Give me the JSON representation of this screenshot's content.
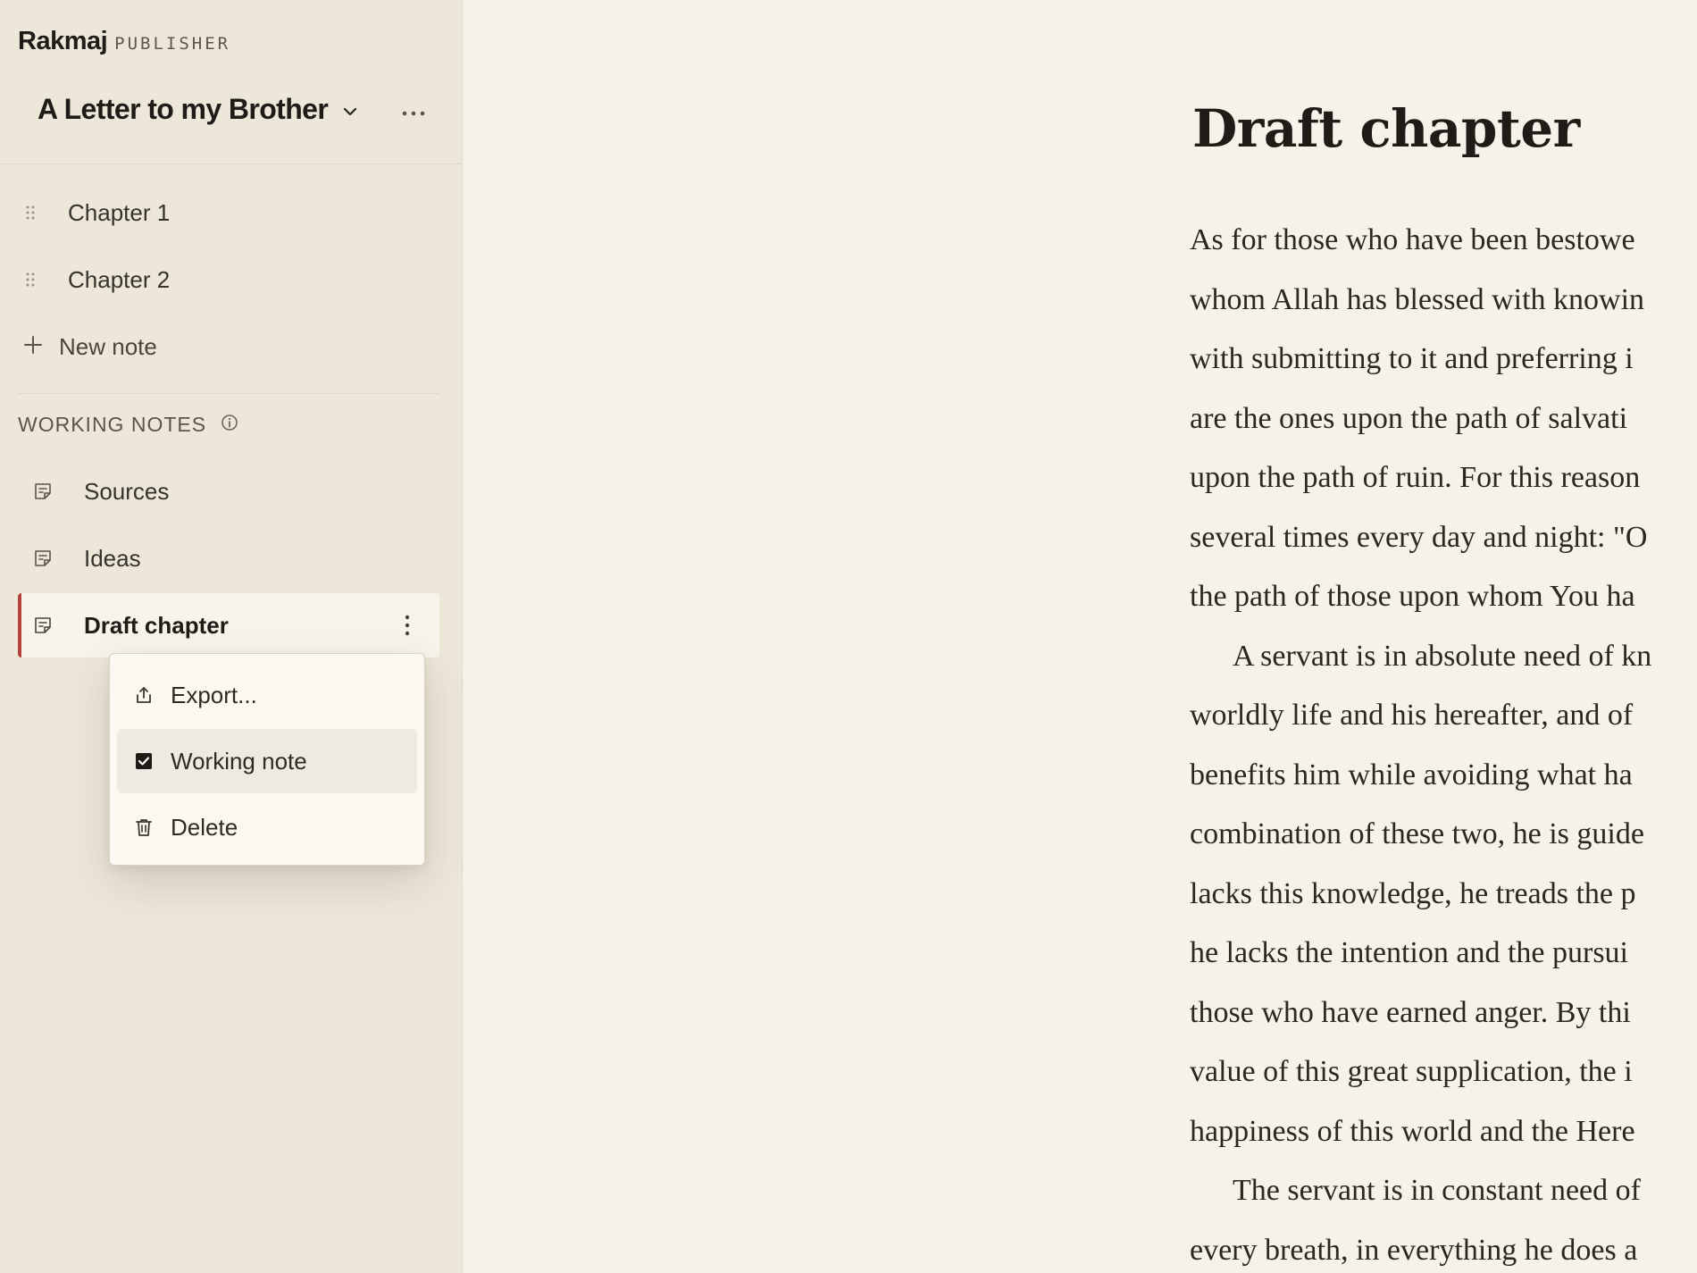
{
  "brand": {
    "name": "Rakmaj",
    "tag": "PUBLISHER"
  },
  "project": {
    "title": "A Letter to my Brother"
  },
  "chapters": [
    {
      "label": "Chapter 1"
    },
    {
      "label": "Chapter 2"
    }
  ],
  "new_note_label": "New note",
  "working_notes": {
    "title": "WORKING NOTES",
    "items": [
      {
        "label": "Sources"
      },
      {
        "label": "Ideas"
      },
      {
        "label": "Draft chapter"
      }
    ]
  },
  "context_menu": {
    "items": [
      {
        "label": "Export..."
      },
      {
        "label": "Working note"
      },
      {
        "label": "Delete"
      }
    ]
  },
  "document": {
    "title": "Draft chapter",
    "lines": [
      "As for those who have been bestowe",
      "whom Allah has blessed with knowin",
      "with submitting to it and preferring i",
      "are the ones upon the path of salvati",
      "upon the path of ruin. For this reason",
      "several times every day and night: \"O",
      "the path of those upon whom You ha",
      "A servant is in absolute need of kn",
      "worldly life and his hereafter, and of",
      "benefits him while avoiding what ha",
      "combination of these two, he is guide",
      "lacks this knowledge, he treads the p",
      "he lacks the intention and the pursui",
      "those who have earned anger. By thi",
      "value of this great supplication, the i",
      "happiness of this world and the Here",
      "The servant is in constant need of",
      "every breath, in everything he does a"
    ]
  },
  "colors": {
    "sidebar_bg": "#ede7da",
    "content_bg": "#f5f2ea",
    "active_accent": "#b5413a"
  }
}
